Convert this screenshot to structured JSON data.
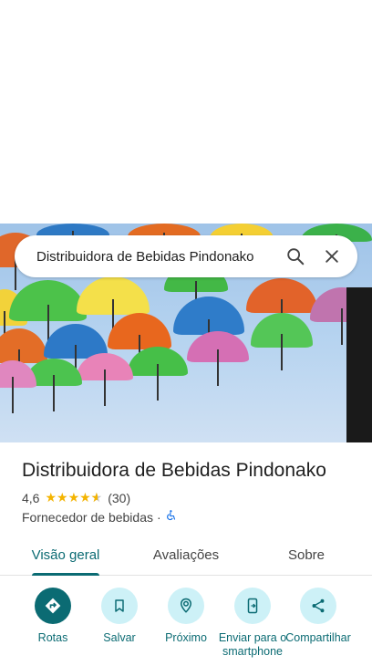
{
  "search": {
    "query": "Distribuidora de Bebidas Pindonako"
  },
  "place": {
    "name": "Distribuidora de Bebidas Pindonako",
    "rating": "4,6",
    "reviews": "(30)",
    "category": "Fornecedor de bebidas",
    "separator": "·"
  },
  "tabs": [
    {
      "label": "Visão geral"
    },
    {
      "label": "Avaliações"
    },
    {
      "label": "Sobre"
    }
  ],
  "actions": [
    {
      "label": "Rotas"
    },
    {
      "label": "Salvar"
    },
    {
      "label": "Próximo"
    },
    {
      "label": "Enviar para o smartphone"
    },
    {
      "label": "Compartilhar"
    }
  ],
  "colors": {
    "accent": "#0b6b73",
    "chip": "#cdf1f7",
    "star": "#f4b400"
  },
  "icons": [
    "search-icon",
    "close-icon",
    "star-icon",
    "wheelchair-icon",
    "directions-icon",
    "bookmark-icon",
    "nearby-icon",
    "send-to-phone-icon",
    "share-icon"
  ]
}
